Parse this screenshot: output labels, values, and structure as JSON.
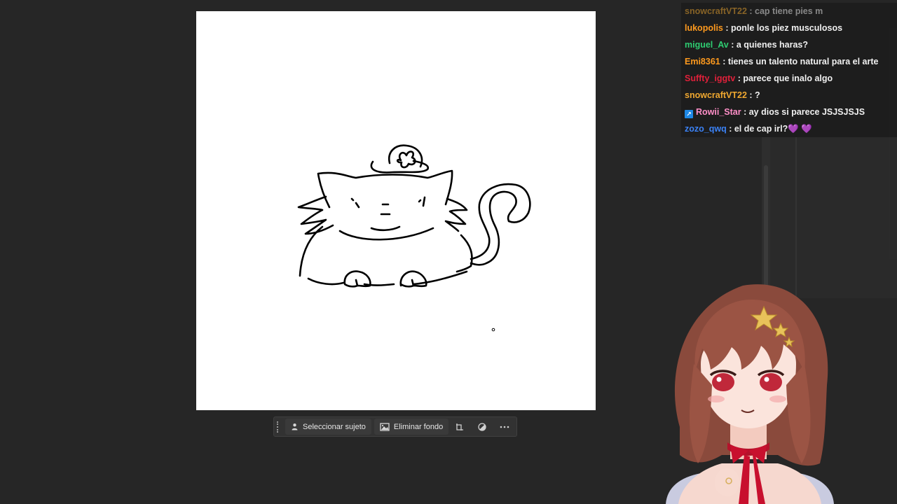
{
  "canvas": {
    "background": "#ffffff",
    "drawing": "cat-doodle"
  },
  "taskbar": {
    "select_subject_label": "Seleccionar sujeto",
    "remove_background_label": "Eliminar fondo",
    "icons": [
      "grip-icon",
      "person-select-icon",
      "image-remove-icon",
      "crop-transform-icon",
      "adjust-contrast-icon",
      "more-options-icon"
    ]
  },
  "chat": {
    "messages": [
      {
        "user": "snowcraftVT22",
        "color": "#f0a830",
        "text": "cap tiene pies m",
        "faded": true
      },
      {
        "user": "lukopolis",
        "color": "#ff9a1e",
        "text": "ponle los piez musculosos"
      },
      {
        "user": "miguel_Av",
        "color": "#2ecc71",
        "text": "a quienes haras?"
      },
      {
        "user": "Emi8361",
        "color": "#ff9a1e",
        "text": "tienes un talento natural para el arte"
      },
      {
        "user": "Suffty_iggtv",
        "color": "#e0203a",
        "text": "parece que inalo algo"
      },
      {
        "user": "snowcraftVT22",
        "color": "#f0a830",
        "text": "?"
      },
      {
        "user": "Rowii_Star",
        "color": "#ff8fc8",
        "text": "ay dios si parece JSJSJSJS",
        "badge": true
      },
      {
        "user": "zozo_qwq",
        "color": "#3b82f6",
        "text": "el de cap irl?💜 💜"
      }
    ],
    "separator": ":"
  },
  "avatar": {
    "name": "vtuber-avatar"
  }
}
